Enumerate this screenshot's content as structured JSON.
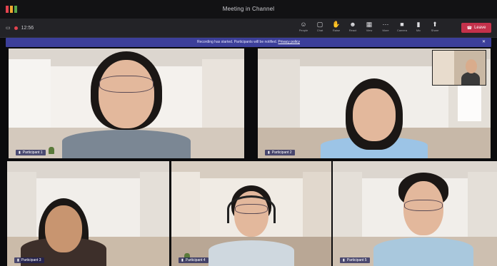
{
  "window": {
    "title": "Meeting in Channel",
    "logo_colors": [
      "#e3434f",
      "#f0a830",
      "#57a64a"
    ]
  },
  "toolbar": {
    "meeting_time": "12:56",
    "controls": [
      {
        "icon": "people-icon",
        "label": "People"
      },
      {
        "icon": "chat-icon",
        "label": "Chat"
      },
      {
        "icon": "hand-icon",
        "label": "Raise"
      },
      {
        "icon": "reactions-icon",
        "label": "React"
      },
      {
        "icon": "view-icon",
        "label": "View"
      },
      {
        "icon": "more-icon",
        "label": "More"
      },
      {
        "icon": "camera-icon",
        "label": "Camera"
      },
      {
        "icon": "mic-icon",
        "label": "Mic"
      },
      {
        "icon": "share-icon",
        "label": "Share"
      }
    ],
    "leave_label": "Leave"
  },
  "banner": {
    "text": "Recording has started. Participants will be notified.",
    "link": "Privacy policy",
    "close_icon": "close-icon"
  },
  "participants": [
    {
      "name": "Participant 1",
      "shirt": "#7b8794",
      "hair": "#1f1a18"
    },
    {
      "name": "Participant 2",
      "shirt": "#9cc4e6",
      "hair": "#141110"
    },
    {
      "name": "Participant 3",
      "shirt": "#3d2f2a",
      "hair": "#2a1d17"
    },
    {
      "name": "Participant 4",
      "shirt": "#cfd8df",
      "hair": "#191616"
    },
    {
      "name": "Participant 5",
      "shirt": "#a9c8dd",
      "hair": "#161312"
    }
  ],
  "colors": {
    "accent": "#3c3f9a",
    "leave": "#c4314b",
    "background": "#0b0b0d"
  }
}
